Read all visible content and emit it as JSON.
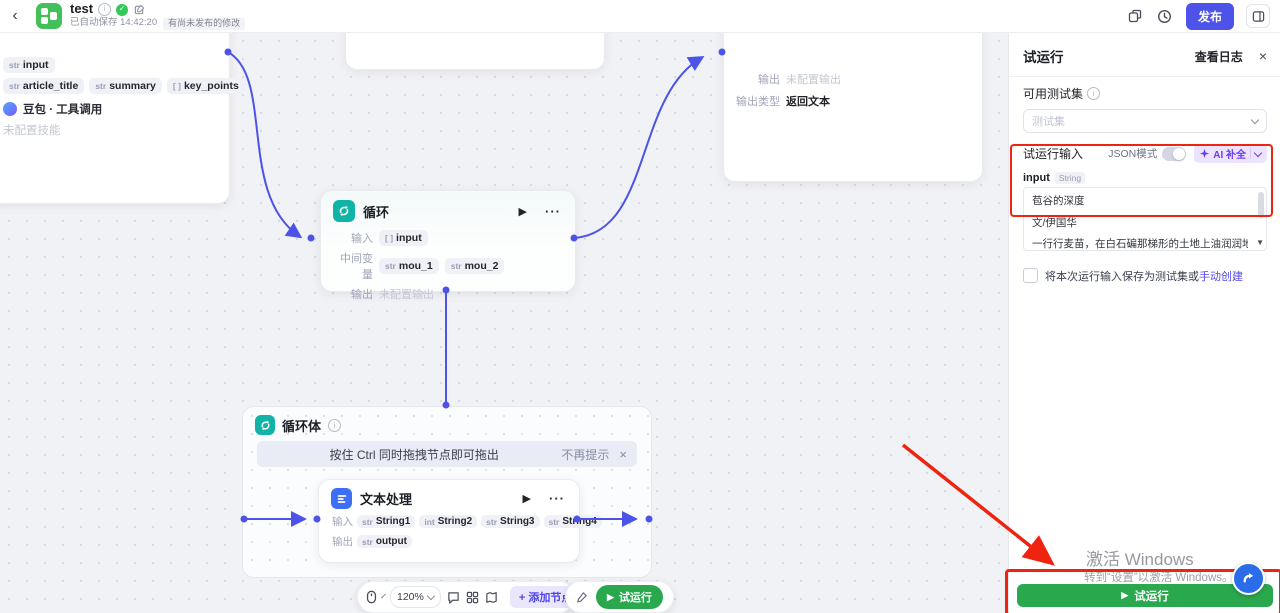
{
  "icons": {
    "back": "‹",
    "play": "▶",
    "more": "···",
    "close": "×",
    "check": "✓",
    "info": "i",
    "scroll_down": "▼",
    "zoom_pct": "120%"
  },
  "topbar": {
    "title": "test",
    "autosave": "已自动保存 14:42:20",
    "unpublished": "有尚未发布的修改",
    "publish": "发布"
  },
  "canvas": {
    "agent_node": {
      "top_tag": {
        "type": "str",
        "name": "input"
      },
      "out_tags": [
        {
          "type": "str",
          "name": "article_title"
        },
        {
          "type": "str",
          "name": "summary"
        },
        {
          "type": "[ ]",
          "name": "key_points"
        }
      ],
      "tool": "豆包 · 工具调用",
      "skill": "未配置技能"
    },
    "return_node": {
      "output_label": "输出",
      "output_value": "未配置输出",
      "type_label": "输出类型",
      "type_value": "返回文本"
    },
    "loop_node": {
      "title": "循环",
      "input_label": "输入",
      "input_tag": {
        "type": "[ ]",
        "name": "input"
      },
      "mid_label": "中间变量",
      "mid_tags": [
        {
          "type": "str",
          "name": "mou_1"
        },
        {
          "type": "str",
          "name": "mou_2"
        }
      ],
      "output_label": "输出",
      "output_value": "未配置输出"
    },
    "loop_body": {
      "title": "循环体",
      "banner": "按住 Ctrl 同时拖拽节点即可拖出",
      "dismiss": "不再提示"
    },
    "text_node": {
      "title": "文本处理",
      "input_label": "输入",
      "input_tags": [
        {
          "type": "str",
          "name": "String1"
        },
        {
          "type": "int",
          "name": "String2"
        },
        {
          "type": "str",
          "name": "String3"
        },
        {
          "type": "str",
          "name": "String4"
        }
      ],
      "output_label": "输出",
      "output_tag": {
        "type": "str",
        "name": "output"
      }
    }
  },
  "toolbar": {
    "zoom": "120%",
    "add_node": "+ 添加节点",
    "run": "试运行"
  },
  "panel": {
    "title": "试运行",
    "view_logs": "查看日志",
    "testset_label": "可用测试集",
    "testset_placeholder": "测试集",
    "input_section": "试运行输入",
    "json_mode": "JSON模式",
    "ai_complete": "AI 补全",
    "field_name": "input",
    "field_type": "String",
    "text_lines": [
      "苞谷的深度",
      "文/伊国华",
      "一行行麦苗，在白石碥那梯形的土地上油润润地青绿着，在冬日万物萧疏"
    ],
    "save_hint": "将本次运行输入保存为测试集或",
    "manual_create": "手动创建",
    "run_button": "试运行"
  },
  "watermark": {
    "line1": "激活 Windows",
    "line2": "转到“设置”以激活 Windows。"
  },
  "colors": {
    "accent": "#4d53e8",
    "run_green": "#2aa84e",
    "brand_green": "#43c05a",
    "loop_teal": "#0fb3a8",
    "text_blue": "#3d6ef5",
    "annotation_red": "#ee2411"
  }
}
